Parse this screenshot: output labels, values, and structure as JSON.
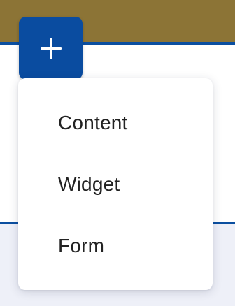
{
  "add_button": {
    "icon": "plus-icon"
  },
  "menu": {
    "items": [
      {
        "label": "Content"
      },
      {
        "label": "Widget"
      },
      {
        "label": "Form"
      }
    ]
  },
  "colors": {
    "header_band": "#8c7436",
    "accent_blue": "#0a4ca0",
    "bottom_panel": "#eef0f8",
    "menu_text": "#222222"
  }
}
